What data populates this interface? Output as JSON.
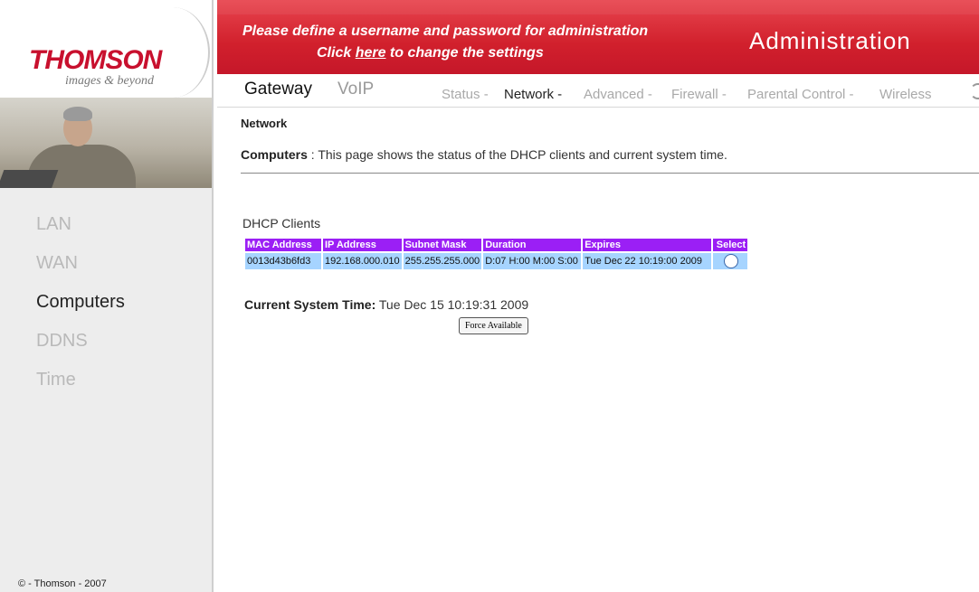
{
  "brand": {
    "logo_text": "THOMSON",
    "tagline": "images & beyond"
  },
  "banner": {
    "line1": "Please define a username and password for administration",
    "line2_prefix": "Click ",
    "line2_link": "here",
    "line2_suffix": " to change the settings",
    "section_title": "Administration",
    "color": "#d1202c"
  },
  "top_tabs": [
    {
      "label": "Gateway",
      "active": true
    },
    {
      "label": "VoIP",
      "active": false
    }
  ],
  "sub_menu": [
    {
      "label": "Status -",
      "active": false
    },
    {
      "label": "Network -",
      "active": true
    },
    {
      "label": "Advanced -",
      "active": false
    },
    {
      "label": "Firewall -",
      "active": false
    },
    {
      "label": "Parental Control -",
      "active": false
    },
    {
      "label": "Wireless",
      "active": false
    }
  ],
  "sidebar": {
    "items": [
      {
        "label": "LAN",
        "active": false
      },
      {
        "label": "WAN",
        "active": false
      },
      {
        "label": "Computers",
        "active": true
      },
      {
        "label": "DDNS",
        "active": false
      },
      {
        "label": "Time",
        "active": false
      }
    ],
    "copyright": "© - Thomson - 2007"
  },
  "page": {
    "title": "Network",
    "desc_label": "Computers",
    "desc_sep": " : ",
    "desc_text": "This page shows the status of the DHCP clients and current system time."
  },
  "dhcp": {
    "title": "DHCP Clients",
    "columns": [
      "MAC Address",
      "IP Address",
      "Subnet Mask",
      "Duration",
      "Expires",
      "Select"
    ],
    "rows": [
      [
        "0013d43b6fd3",
        "192.168.000.010",
        "255.255.255.000",
        "D:07 H:00 M:00 S:00",
        "Tue Dec 22 10:19:00 2009"
      ]
    ],
    "header_color": "#9b1ff5",
    "row_color": "#a6d4ff"
  },
  "system_time": {
    "label": "Current System Time:",
    "value": "Tue Dec 15 10:19:31 2009"
  },
  "force_button": "Force Available"
}
